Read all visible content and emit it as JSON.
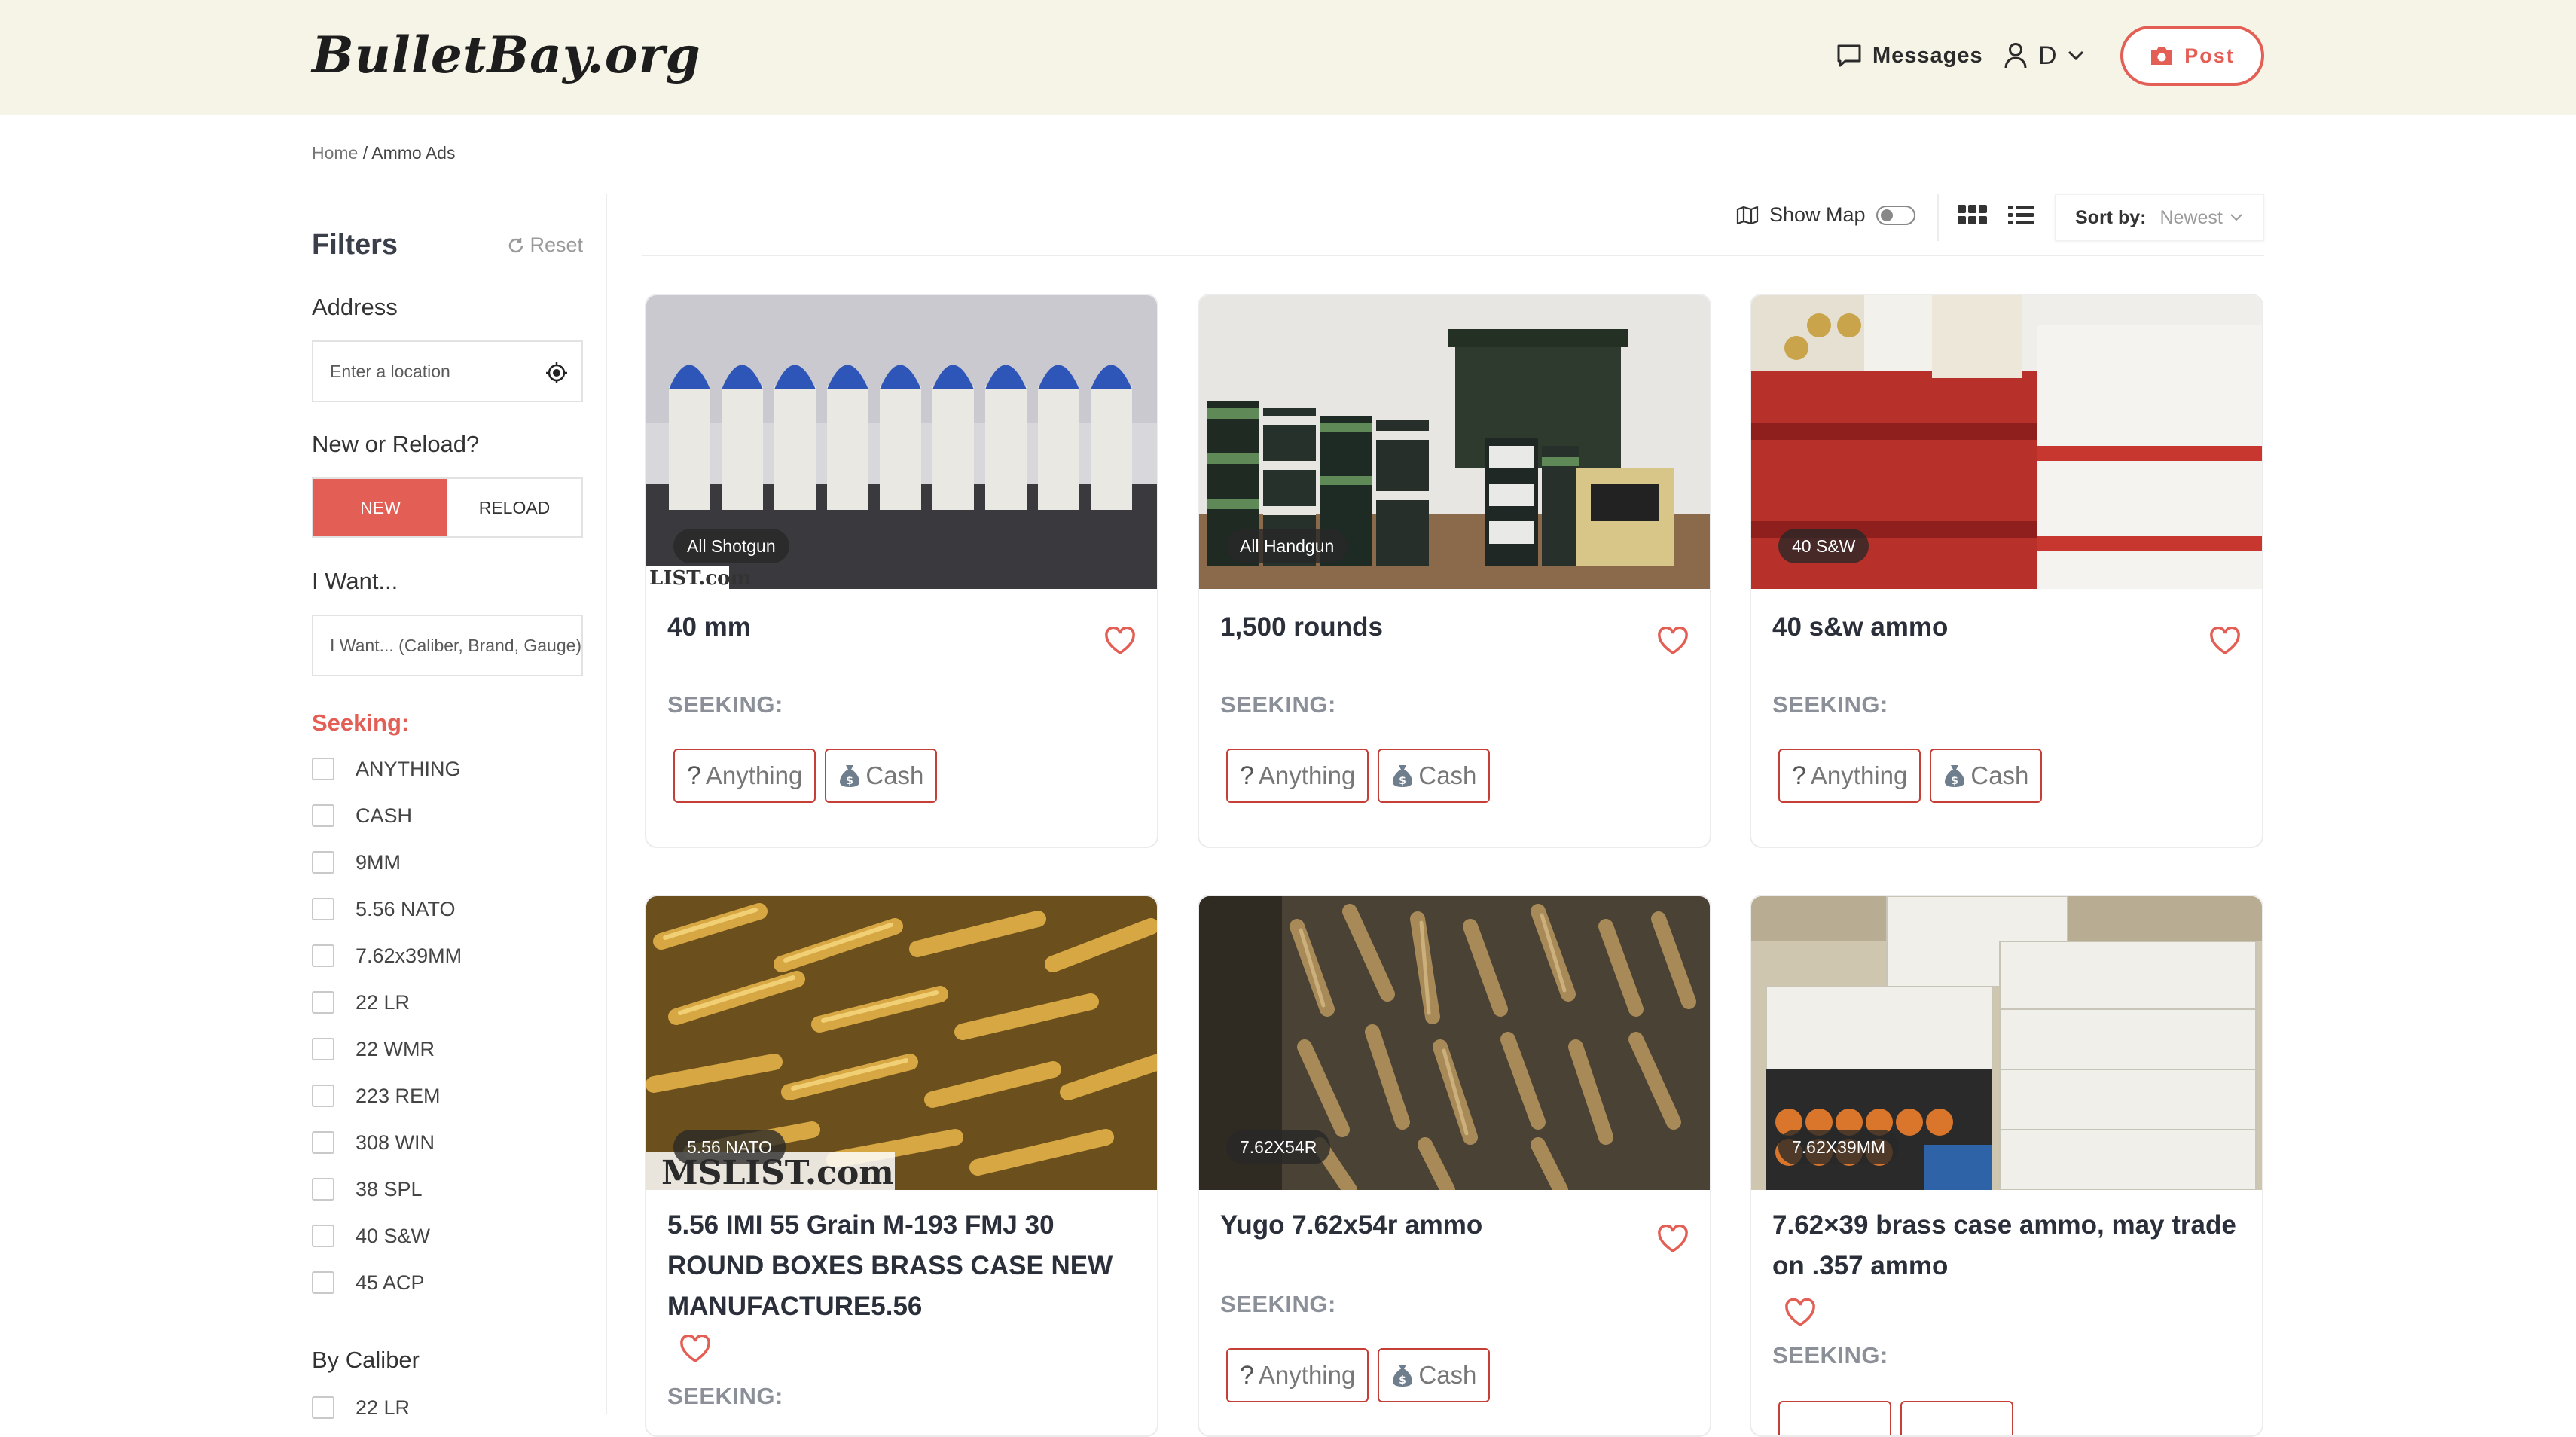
{
  "header": {
    "logo": "BulletBay.org",
    "messages_label": "Messages",
    "user_initial": "D",
    "post_label": "Post"
  },
  "breadcrumb": {
    "home": "Home",
    "separator": "/",
    "current": "Ammo Ads"
  },
  "filters": {
    "title": "Filters",
    "reset_label": "Reset",
    "address_label": "Address",
    "address_placeholder": "Enter a location",
    "new_reload_label": "New or Reload?",
    "new_label": "NEW",
    "reload_label": "RELOAD",
    "iwant_label": "I Want...",
    "iwant_placeholder": "I Want... (Caliber, Brand, Gauge)",
    "seeking_label": "Seeking:",
    "seeking_options": [
      "ANYTHING",
      "CASH",
      "9MM",
      "5.56 NATO",
      "7.62x39MM",
      "22 LR",
      "22 WMR",
      "223 REM",
      "308 WIN",
      "38 SPL",
      "40 S&W",
      "45 ACP"
    ],
    "by_caliber_label": "By Caliber",
    "caliber_first": "22 LR"
  },
  "toolbar": {
    "show_map_label": "Show Map",
    "show_map_on": false,
    "sort_label": "Sort by:",
    "sort_value": "Newest"
  },
  "listings": [
    {
      "category": "All Shotgun",
      "title": "40 mm",
      "seeking_label": "SEEKING:",
      "tags": [
        "Anything",
        "Cash"
      ],
      "watermark": "LIST.com"
    },
    {
      "category": "All Handgun",
      "title": "1,500 rounds",
      "seeking_label": "SEEKING:",
      "tags": [
        "Anything",
        "Cash"
      ]
    },
    {
      "category": "40 S&W",
      "title": "40 s&w ammo",
      "seeking_label": "SEEKING:",
      "tags": [
        "Anything",
        "Cash"
      ]
    },
    {
      "category": "5.56 NATO",
      "title": "5.56 IMI 55 Grain M-193 FMJ 30 ROUND BOXES BRASS CASE NEW MANUFACTURE5.56",
      "seeking_label": "SEEKING:",
      "tags": [],
      "watermark": "MSLIST.com"
    },
    {
      "category": "7.62X54R",
      "title": "Yugo 7.62x54r ammo",
      "seeking_label": "SEEKING:",
      "tags": [
        "Anything",
        "Cash"
      ]
    },
    {
      "category": "7.62X39MM",
      "title": "7.62×39 brass case ammo, may trade on .357 ammo",
      "seeking_label": "SEEKING:",
      "tags": []
    }
  ],
  "colors": {
    "accent": "#e35f55",
    "header_bg": "#f6f4e6",
    "tag_border": "#c63f37"
  }
}
